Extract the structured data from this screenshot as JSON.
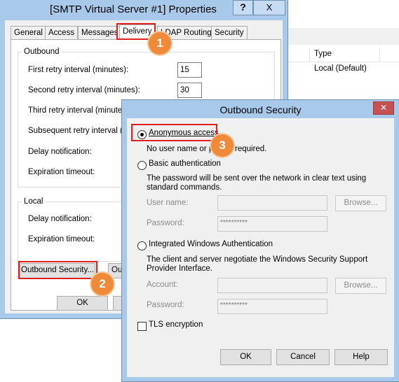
{
  "background_window": {
    "column_type": "Type",
    "row_type_value": "Local (Default)"
  },
  "properties_dialog": {
    "title": "[SMTP Virtual Server #1] Properties",
    "help_glyph": "?",
    "close_glyph": "X",
    "tabs": [
      "General",
      "Access",
      "Messages",
      "Delivery",
      "LDAP Routing",
      "Security"
    ],
    "active_tab": "Delivery",
    "outbound_group": "Outbound",
    "first_retry_label": "First retry interval (minutes):",
    "first_retry_value": "15",
    "second_retry_label": "Second retry interval (minutes):",
    "second_retry_value": "30",
    "third_retry_label": "Third retry interval (minutes):",
    "subsequent_retry_label": "Subsequent retry interval (minutes):",
    "delay_notification_label": "Delay notification:",
    "expiration_timeout_label": "Expiration timeout:",
    "local_group": "Local",
    "local_delay_label": "Delay notification:",
    "local_expiration_label": "Expiration timeout:",
    "outbound_security_button": "Outbound Security...",
    "outbound_connections_button_partial": "Out",
    "ok_button": "OK"
  },
  "outbound_security_dialog": {
    "title": "Outbound Security",
    "close_glyph": "✕",
    "anonymous_label": "Anonymous access",
    "anonymous_desc": "No user name or password required.",
    "anonymous_desc_left": "No user name or pa",
    "anonymous_desc_right": "required.",
    "basic_label": "Basic authentication",
    "basic_desc": "The password will be sent over the network in clear text using standard commands.",
    "user_name_label": "User name:",
    "password_label": "Password:",
    "password_mask": "**********",
    "browse_button": "Browse...",
    "integrated_label": "Integrated Windows Authentication",
    "integrated_desc": "The client and server negotiate the Windows Security Support Provider Interface.",
    "account_label": "Account:",
    "password2_label": "Password:",
    "password2_mask": "**********",
    "browse2_button": "Browse...",
    "tls_label": "TLS encryption",
    "ok_button": "OK",
    "cancel_button": "Cancel",
    "help_button": "Help",
    "selected_option": "Anonymous access"
  },
  "callouts": [
    "1",
    "2",
    "3"
  ],
  "colors": {
    "title_bar": "#a9c9ea",
    "callout": "#ee8a3a",
    "highlight_box": "#e02020",
    "close_button": "#c75050"
  }
}
